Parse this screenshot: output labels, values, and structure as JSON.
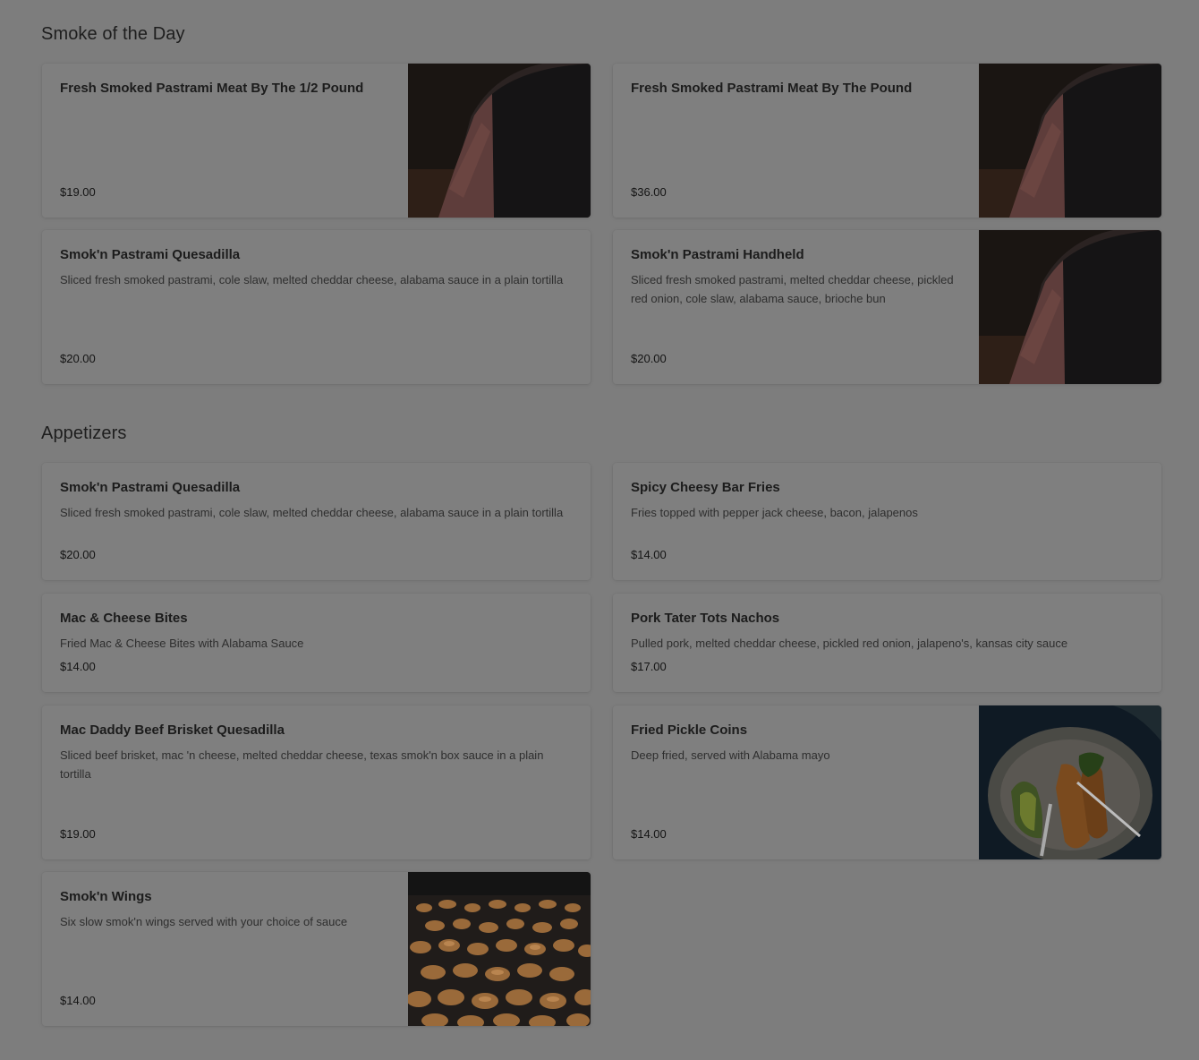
{
  "sections": {
    "smoke_of_the_day": {
      "title": "Smoke of the Day",
      "items": [
        {
          "name": "Fresh Smoked Pastrami Meat By The 1/2 Pound",
          "description": "",
          "price": "$19.00",
          "image": "pastrami-photo"
        },
        {
          "name": "Fresh Smoked Pastrami Meat By The Pound",
          "description": "",
          "price": "$36.00",
          "image": "pastrami-photo"
        },
        {
          "name": "Smok'n Pastrami Quesadilla",
          "description": "Sliced fresh smoked pastrami, cole slaw, melted cheddar cheese, alabama sauce in a plain tortilla",
          "price": "$20.00"
        },
        {
          "name": "Smok'n Pastrami Handheld",
          "description": "Sliced fresh smoked pastrami, melted cheddar cheese, pickled red onion, cole slaw, alabama sauce, brioche bun",
          "price": "$20.00",
          "image": "pastrami-photo"
        }
      ]
    },
    "appetizers": {
      "title": "Appetizers",
      "items": [
        {
          "name": "Smok'n Pastrami Quesadilla",
          "description": "Sliced fresh smoked pastrami, cole slaw, melted cheddar cheese, alabama sauce in a plain tortilla",
          "price": "$20.00"
        },
        {
          "name": "Spicy Cheesy Bar Fries",
          "description": "Fries topped with pepper jack cheese, bacon, jalapenos",
          "price": "$14.00"
        },
        {
          "name": "Mac & Cheese Bites",
          "description": "Fried Mac & Cheese Bites with Alabama Sauce",
          "price": "$14.00"
        },
        {
          "name": "Pork Tater Tots Nachos",
          "description": "Pulled pork, melted cheddar cheese, pickled red onion, jalapeno's, kansas city sauce",
          "price": "$17.00"
        },
        {
          "name": "Mac Daddy Beef Brisket Quesadilla",
          "description": "Sliced beef brisket, mac 'n cheese, melted cheddar cheese, texas smok'n box sauce in a plain tortilla",
          "price": "$19.00"
        },
        {
          "name": "Fried Pickle Coins",
          "description": "Deep fried, served with Alabama mayo",
          "price": "$14.00",
          "image": "fried-pickle-photo"
        },
        {
          "name": "Smok'n Wings",
          "description": "Six slow smok'n wings served with your choice of sauce",
          "price": "$14.00",
          "image": "wings-photo"
        }
      ]
    }
  }
}
